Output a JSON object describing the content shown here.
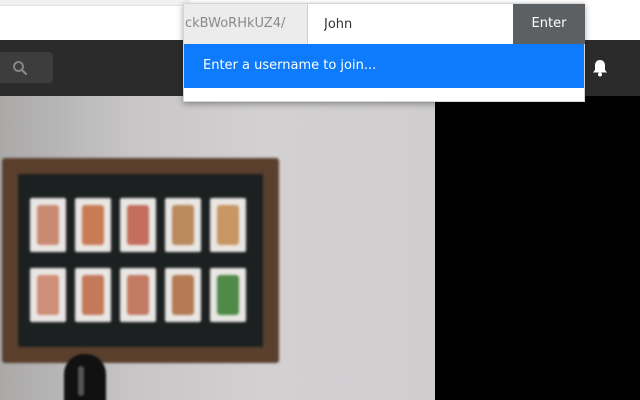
{
  "join_form": {
    "room_prefix": "ckBWoRHkUZ4/",
    "username_value": "John",
    "enter_label": "Enter",
    "hint": "Enter a username to join..."
  },
  "header": {
    "search_icon": "search-icon",
    "notification_icon": "bell-icon"
  },
  "colors": {
    "accent": "#0d7bfb",
    "header_bg": "#2b2b2b",
    "enter_button": "#5c6063"
  }
}
